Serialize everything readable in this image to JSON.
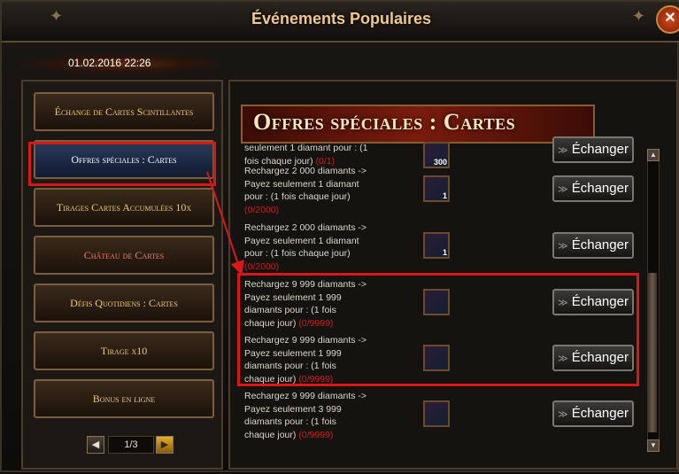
{
  "window": {
    "title": "Événements Populaires",
    "date": "01.02.2016 22:26",
    "close_icon": "close-icon"
  },
  "sidebar": {
    "items": [
      {
        "label": "Échange de Cartes Scintillantes"
      },
      {
        "label": "Offres spéciales : Cartes"
      },
      {
        "label": "Tirages Cartes Accumulées 10x"
      },
      {
        "label": "Château de Cartes"
      },
      {
        "label": "Défis Quotidiens : Cartes"
      },
      {
        "label": "Tirage x10"
      },
      {
        "label": "Bonus en ligne"
      }
    ],
    "pager": {
      "current": "1/3",
      "prev_icon": "chevron-left-icon",
      "next_icon": "chevron-right-icon"
    }
  },
  "main": {
    "banner_title": "Offres spéciales : Cartes",
    "offers": [
      {
        "line1": "seulement 1 diamant pour :  (1",
        "line2": "fois chaque jour)",
        "line3": "",
        "line4": "",
        "progress": "(0/1)",
        "badge": "300",
        "button": "Échanger"
      },
      {
        "line1": "Rechargez 2 000 diamants ->",
        "line2": "Payez seulement 1 diamant",
        "line3": "pour :  (1 fois chaque jour)",
        "line4": "",
        "progress": "(0/2000)",
        "badge": "1",
        "button": "Échanger"
      },
      {
        "line1": "Rechargez 2 000 diamants ->",
        "line2": "Payez seulement 1 diamant",
        "line3": "pour :  (1 fois chaque jour)",
        "line4": "",
        "progress": "(0/2000)",
        "badge": "1",
        "button": "Échanger"
      },
      {
        "line1": "Rechargez 9 999 diamants ->",
        "line2": "Payez seulement 1 999",
        "line3": "diamants pour :  (1 fois",
        "line4": "chaque jour)",
        "progress": "(0/9999)",
        "badge": "",
        "button": "Échanger"
      },
      {
        "line1": "Rechargez 9 999 diamants ->",
        "line2": "Payez seulement 1 999",
        "line3": "diamants pour :  (1 fois",
        "line4": "chaque jour)",
        "progress": "(0/9999)",
        "badge": "",
        "button": "Échanger"
      },
      {
        "line1": "Rechargez 9 999 diamants ->",
        "line2": "Payez seulement 3 999",
        "line3": "diamants pour :  (1 fois",
        "line4": "chaque jour)",
        "progress": "(0/9999)",
        "badge": "",
        "button": "Échanger"
      }
    ]
  }
}
